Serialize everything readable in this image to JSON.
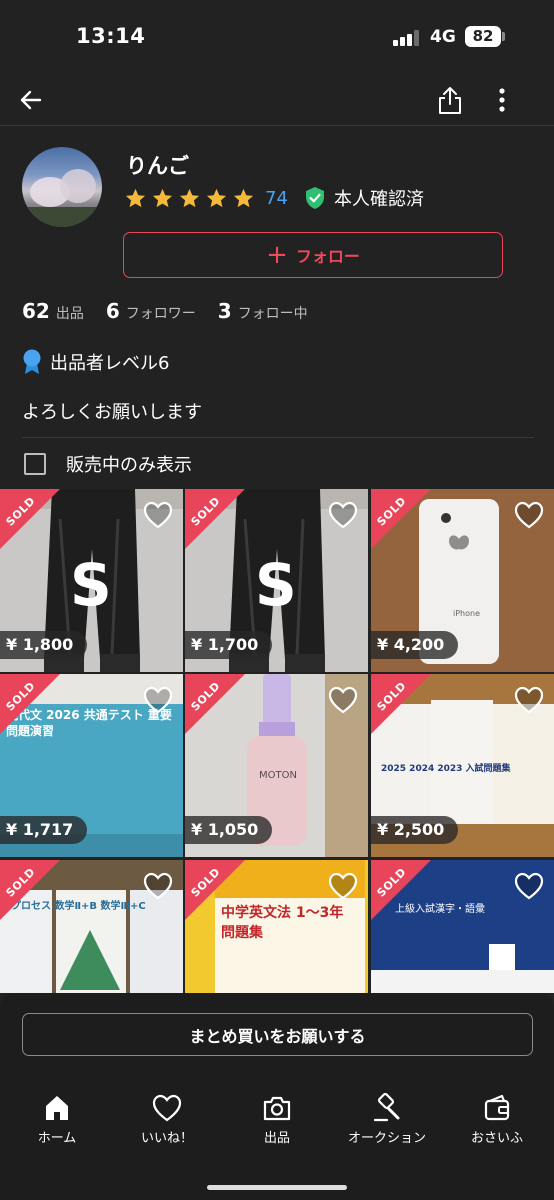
{
  "status_bar": {
    "time": "13:14",
    "network": "4G",
    "battery": "82"
  },
  "profile": {
    "name": "りんご",
    "rating_count": "74",
    "verified_label": "本人確認済",
    "follow_label": "フォロー",
    "stats": [
      {
        "num": "62",
        "label": "出品"
      },
      {
        "num": "6",
        "label": "フォロワー"
      },
      {
        "num": "3",
        "label": "フォロー中"
      }
    ],
    "seller_level": "出品者レベル6",
    "bio": "よろしくお願いします",
    "filter_label": "販売中のみ表示"
  },
  "items": [
    {
      "price": "¥ 1,800",
      "sold": "SOLD",
      "label": "S"
    },
    {
      "price": "¥ 1,700",
      "sold": "SOLD",
      "label": "S"
    },
    {
      "price": "¥ 4,200",
      "sold": "SOLD",
      "label": "iPhone"
    },
    {
      "price": "¥ 1,717",
      "sold": "SOLD",
      "label": "現代文 2026 共通テスト 重要問題演習"
    },
    {
      "price": "¥ 1,050",
      "sold": "SOLD",
      "label": "MOTON"
    },
    {
      "price": "¥ 2,500",
      "sold": "SOLD",
      "label": "2025 2024 2023 入試問題集"
    },
    {
      "price": "",
      "sold": "SOLD",
      "label": "4プロセス 数学Ⅱ+B 数学Ⅲ+C"
    },
    {
      "price": "",
      "sold": "SOLD",
      "label": "中学英文法 1〜3年 問題集"
    },
    {
      "price": "",
      "sold": "SOLD",
      "label": "上級入試漢字・語彙"
    }
  ],
  "bulk_button": "まとめ買いをお願いする",
  "tabs": [
    {
      "label": "ホーム",
      "icon": "home-icon"
    },
    {
      "label": "いいね！",
      "icon": "heart-icon"
    },
    {
      "label": "出品",
      "icon": "camera-icon"
    },
    {
      "label": "オークション",
      "icon": "gavel-icon"
    },
    {
      "label": "おさいふ",
      "icon": "wallet-icon"
    }
  ],
  "colors": {
    "accent": "#e9455a",
    "link": "#4aa3f0",
    "verified": "#2fbf71",
    "star": "#f5b93a",
    "background": "#222222"
  }
}
